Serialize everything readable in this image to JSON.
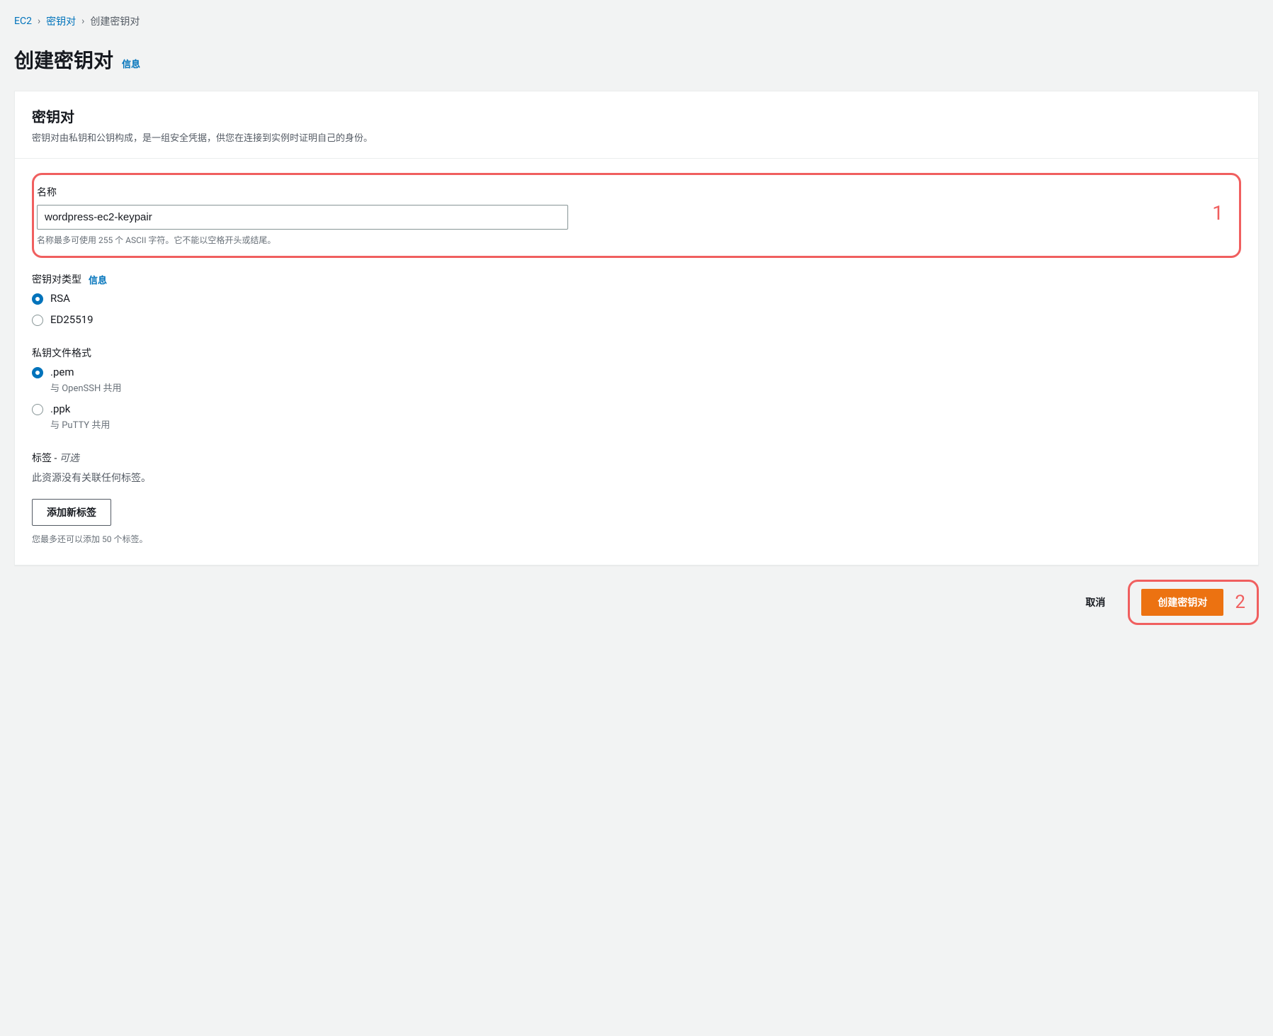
{
  "breadcrumb": {
    "root": "EC2",
    "parent": "密钥对",
    "current": "创建密钥对"
  },
  "page": {
    "title": "创建密钥对",
    "info_link": "信息"
  },
  "panel": {
    "title": "密钥对",
    "description": "密钥对由私钥和公钥构成，是一组安全凭据，供您在连接到实例时证明自己的身份。"
  },
  "name_field": {
    "label": "名称",
    "value": "wordpress-ec2-keypair",
    "hint": "名称最多可使用 255 个 ASCII 字符。它不能以空格开头或结尾。"
  },
  "keypair_type": {
    "label": "密钥对类型",
    "info_link": "信息",
    "options": {
      "rsa": "RSA",
      "ed25519": "ED25519"
    },
    "selected": "rsa"
  },
  "private_key_format": {
    "label": "私钥文件格式",
    "options": {
      "pem": {
        "label": ".pem",
        "sub": "与 OpenSSH 共用"
      },
      "ppk": {
        "label": ".ppk",
        "sub": "与 PuTTY 共用"
      }
    },
    "selected": "pem"
  },
  "tags": {
    "label_prefix": "标签 - ",
    "label_suffix": "可选",
    "empty_text": "此资源没有关联任何标签。",
    "add_button": "添加新标签",
    "hint": "您最多还可以添加 50 个标签。"
  },
  "footer": {
    "cancel": "取消",
    "submit": "创建密钥对"
  },
  "annotations": {
    "one": "1",
    "two": "2"
  }
}
